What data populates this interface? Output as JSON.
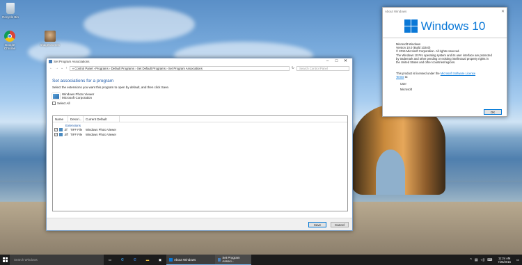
{
  "desktop": {
    "icons": [
      {
        "label": "Recycle Bin"
      },
      {
        "label": "Google Chrome"
      },
      {
        "label": "shageshomec"
      }
    ]
  },
  "assoc_window": {
    "title": "Set Program Associations",
    "breadcrumb": "« Control Panel › Programs › Default Programs › Set Default Programs › Set Program Associations",
    "search_placeholder": "Search Control Panel",
    "heading": "Set associations for a program",
    "instruction": "Select the extensions you want this program to open by default, and then click Save.",
    "program_name": "Windows Photo Viewer",
    "program_company": "Microsoft Corporation",
    "select_all": "Select All",
    "columns": [
      "Name",
      "Descri...",
      "Current Default"
    ],
    "group": "Extensions",
    "rows": [
      {
        "ext": ".tif",
        "desc": "TIFF File",
        "default": "Windows Photo Viewer"
      },
      {
        "ext": ".tiff",
        "desc": "TIFF File",
        "default": "Windows Photo Viewer"
      }
    ],
    "save": "Save",
    "cancel": "Cancel"
  },
  "about_window": {
    "title": "About Windows",
    "logo": "Windows 10",
    "lines": [
      "Microsoft Windows",
      "Version 10.0 (Build 10240)",
      "© 2015 Microsoft Corporation. All rights reserved.",
      "The Windows 10 Pro operating system and its user interface are protected",
      "by trademark and other pending or existing intellectual property rights in",
      "the United States and other countries/regions."
    ],
    "license_text": "This product is licensed under the",
    "license_link": "Microsoft Software License",
    "license_link2": "Terms",
    "license_to": "to:",
    "user1": "User",
    "user2": "Microsoft",
    "ok": "OK"
  },
  "taskbar": {
    "search_placeholder": "Search Windows",
    "apps": [
      "About Windows",
      "Set Program Associ..."
    ],
    "time": "11:24 AM",
    "date": "7/25/2015"
  },
  "colors": {
    "accent": "#1e5aa8",
    "taskbar": "#1c1c1c",
    "win_logo": "#0a78d7"
  }
}
